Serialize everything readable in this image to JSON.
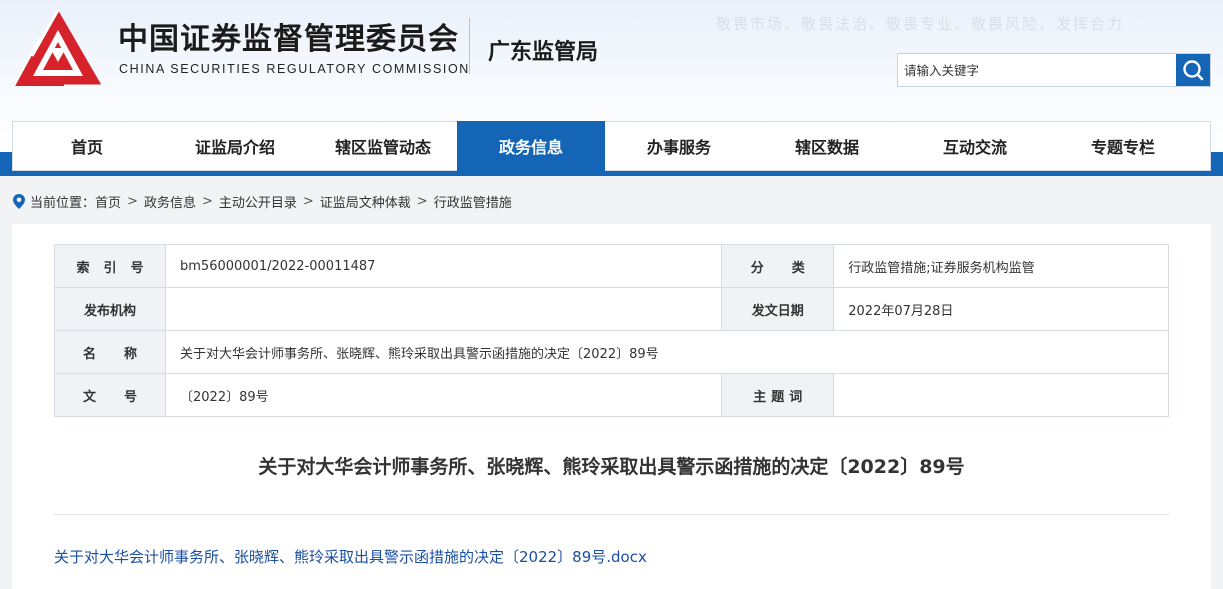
{
  "header": {
    "org_cn": "中国证券监督管理委员会",
    "org_en": "CHINA SECURITIES REGULATORY COMMISSION",
    "bureau": "广东监管局",
    "slogan": "敬畏市场、敬畏法治、敬畏专业、敬畏风险、发挥合力",
    "logo_icon": "csrc-logo-icon",
    "colors": {
      "brand_red": "#d6222b",
      "brand_blue": "#1565b7"
    }
  },
  "search": {
    "placeholder": "请输入关键字",
    "value": "",
    "button_icon": "search-icon"
  },
  "nav": {
    "items": [
      {
        "label": "首页"
      },
      {
        "label": "证监局介绍"
      },
      {
        "label": "辖区监管动态"
      },
      {
        "label": "政务信息"
      },
      {
        "label": "办事服务"
      },
      {
        "label": "辖区数据"
      },
      {
        "label": "互动交流"
      },
      {
        "label": "专题专栏"
      }
    ],
    "active_index": 3
  },
  "breadcrumb": {
    "prefix": "当前位置：",
    "items": [
      "首页",
      "政务信息",
      "主动公开目录",
      "证监局文种体裁",
      "行政监管措施"
    ],
    "separator": ">"
  },
  "info": {
    "index_label": "索引号",
    "index_value": "bm56000001/2022-00011487",
    "category_label": "分类",
    "category_value": "行政监管措施;证券服务机构监管",
    "issuer_label": "发布机构",
    "issuer_value": "",
    "date_label": "发文日期",
    "date_value": "2022年07月28日",
    "name_label": "名称",
    "name_value": "关于对大华会计师事务所、张晓辉、熊玲采取出具警示函措施的决定〔2022〕89号",
    "docno_label": "文号",
    "docno_value": "〔2022〕89号",
    "keywords_label": "主题词",
    "keywords_value": ""
  },
  "document": {
    "title": "关于对大华会计师事务所、张晓辉、熊玲采取出具警示函措施的决定〔2022〕89号",
    "attachment": "关于对大华会计师事务所、张晓辉、熊玲采取出具警示函措施的决定〔2022〕89号.docx"
  }
}
